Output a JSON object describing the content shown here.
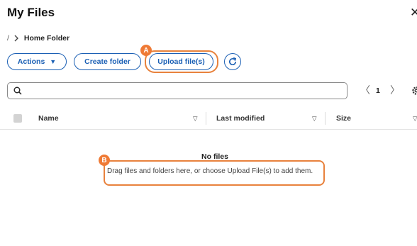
{
  "header": {
    "title": "My Files",
    "close_icon": "close-icon",
    "close_glyph": "✕"
  },
  "breadcrumb": {
    "root": "/",
    "current": "Home Folder",
    "separator_icon": "chevron-right-icon"
  },
  "toolbar": {
    "actions_label": "Actions",
    "actions_caret": "▼",
    "create_folder_label": "Create folder",
    "upload_label": "Upload file(s)",
    "refresh_icon": "refresh-icon",
    "accent_color": "#1a5fb4"
  },
  "annotations": {
    "a": "A",
    "b": "B",
    "highlight_color": "#e8823d",
    "marker_color": "#ef7a35"
  },
  "search": {
    "icon": "search-icon",
    "value": "",
    "placeholder": ""
  },
  "pagination": {
    "prev_glyph": "〈",
    "page": "1",
    "next_glyph": "〉",
    "settings_icon": "settings-icon"
  },
  "table": {
    "columns": [
      {
        "label": "Name",
        "sort_glyph": "▽"
      },
      {
        "label": "Last modified",
        "sort_glyph": "▽"
      },
      {
        "label": "Size",
        "sort_glyph": "▽"
      }
    ]
  },
  "empty_state": {
    "title": "No files",
    "message": "Drag files and folders here, or choose Upload File(s) to add them."
  }
}
